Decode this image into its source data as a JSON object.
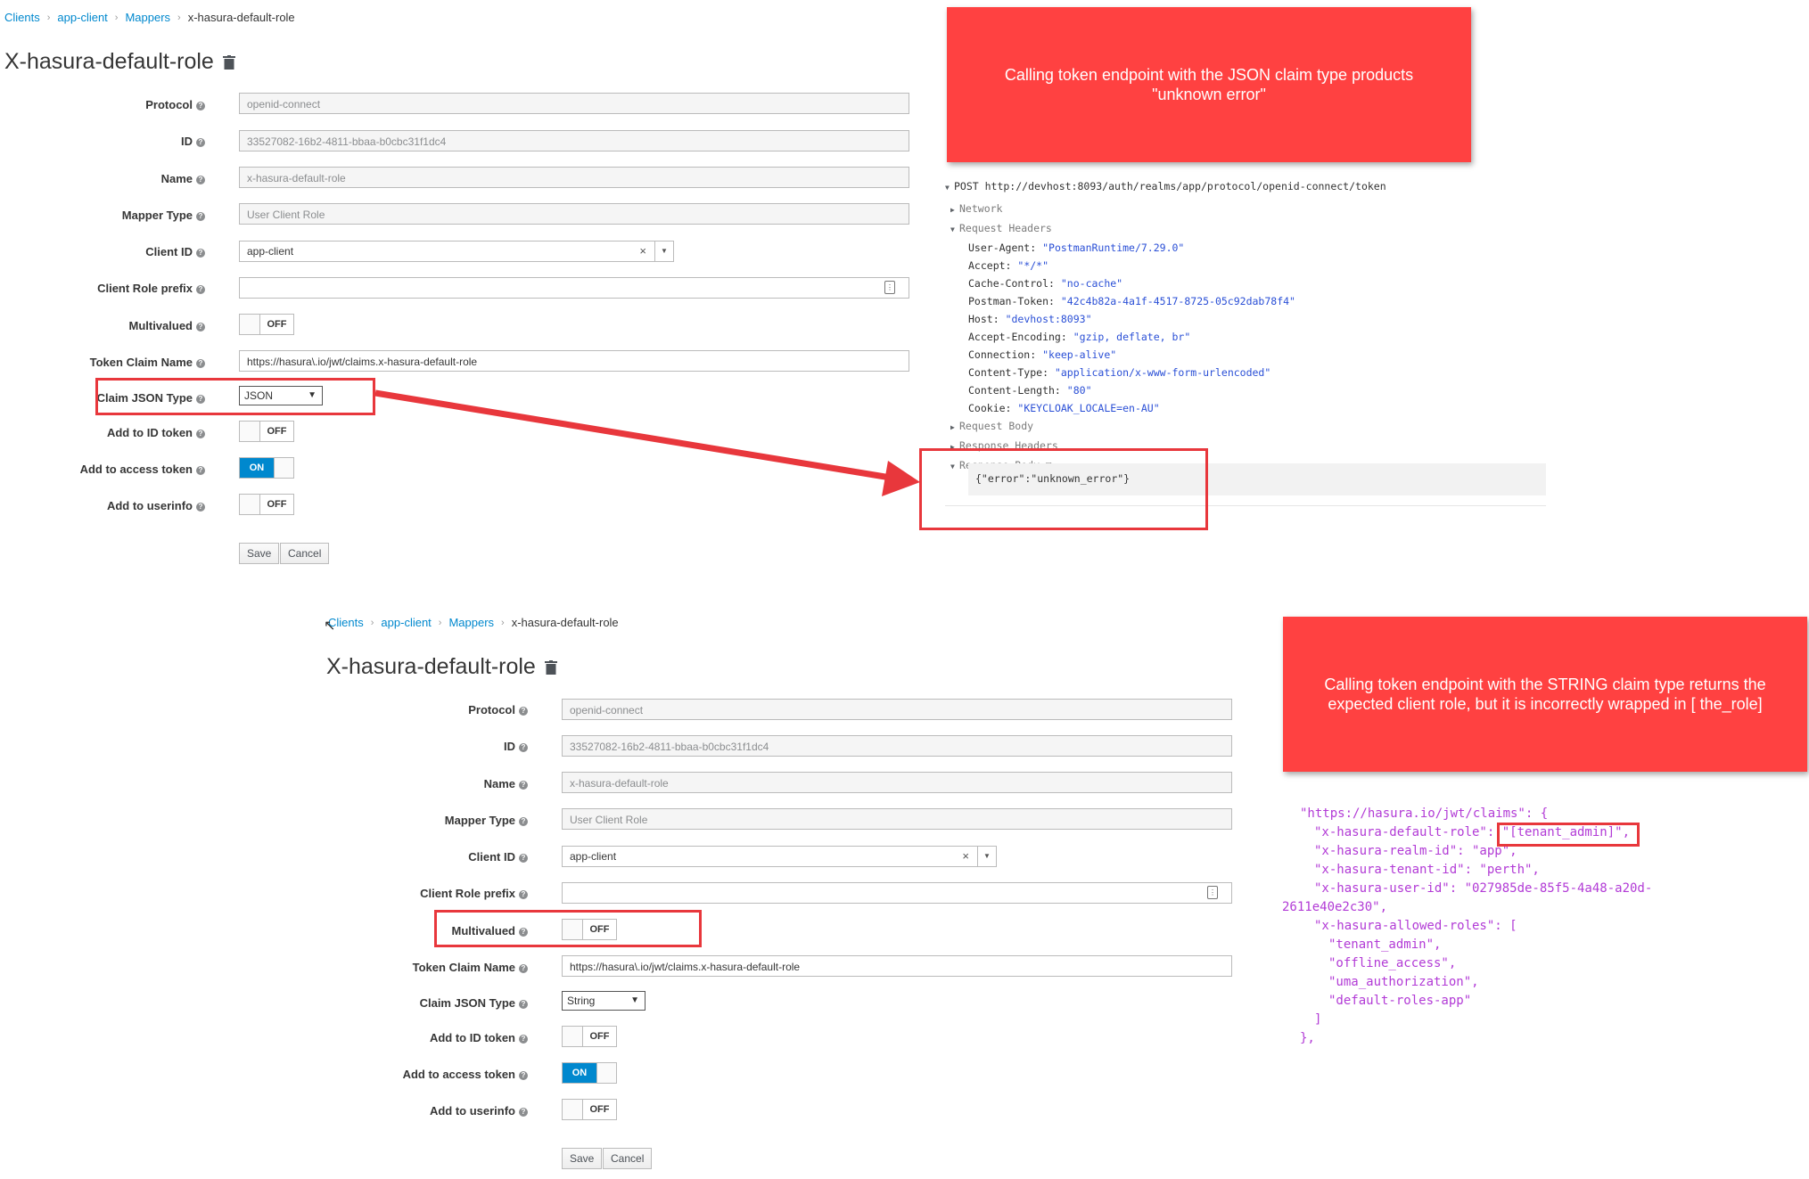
{
  "top": {
    "breadcrumb": [
      "Clients",
      "app-client",
      "Mappers",
      "x-hasura-default-role"
    ],
    "title": "X-hasura-default-role",
    "fields": {
      "protocol": {
        "label": "Protocol",
        "value": "openid-connect"
      },
      "id": {
        "label": "ID",
        "value": "33527082-16b2-4811-bbaa-b0cbc31f1dc4"
      },
      "name": {
        "label": "Name",
        "value": "x-hasura-default-role"
      },
      "mapper_type": {
        "label": "Mapper Type",
        "value": "User Client Role"
      },
      "client_id": {
        "label": "Client ID",
        "value": "app-client"
      },
      "client_role_prefix": {
        "label": "Client Role prefix",
        "value": ""
      },
      "multivalued": {
        "label": "Multivalued",
        "value": "OFF"
      },
      "token_claim_name": {
        "label": "Token Claim Name",
        "value": "https://hasura\\.io/jwt/claims.x-hasura-default-role"
      },
      "claim_json_type": {
        "label": "Claim JSON Type",
        "value": "JSON"
      },
      "add_id_token": {
        "label": "Add to ID token",
        "value": "OFF"
      },
      "add_access_token": {
        "label": "Add to access token",
        "value": "ON"
      },
      "add_userinfo": {
        "label": "Add to userinfo",
        "value": "OFF"
      }
    },
    "save": "Save",
    "cancel": "Cancel"
  },
  "bottom": {
    "breadcrumb": [
      "Clients",
      "app-client",
      "Mappers",
      "x-hasura-default-role"
    ],
    "title": "X-hasura-default-role",
    "fields": {
      "protocol": {
        "label": "Protocol",
        "value": "openid-connect"
      },
      "id": {
        "label": "ID",
        "value": "33527082-16b2-4811-bbaa-b0cbc31f1dc4"
      },
      "name": {
        "label": "Name",
        "value": "x-hasura-default-role"
      },
      "mapper_type": {
        "label": "Mapper Type",
        "value": "User Client Role"
      },
      "client_id": {
        "label": "Client ID",
        "value": "app-client"
      },
      "client_role_prefix": {
        "label": "Client Role prefix",
        "value": ""
      },
      "multivalued": {
        "label": "Multivalued",
        "value": "OFF"
      },
      "token_claim_name": {
        "label": "Token Claim Name",
        "value": "https://hasura\\.io/jwt/claims.x-hasura-default-role"
      },
      "claim_json_type": {
        "label": "Claim JSON Type",
        "value": "String"
      },
      "add_id_token": {
        "label": "Add to ID token",
        "value": "OFF"
      },
      "add_access_token": {
        "label": "Add to access token",
        "value": "ON"
      },
      "add_userinfo": {
        "label": "Add to userinfo",
        "value": "OFF"
      }
    },
    "save": "Save",
    "cancel": "Cancel"
  },
  "callouts": {
    "json": "Calling token endpoint with the JSON claim type products \"unknown error\"",
    "string": "Calling token endpoint with the STRING claim type returns the expected client role, but it is incorrectly wrapped in [ the_role]"
  },
  "devtools": {
    "request_line": "POST http://devhost:8093/auth/realms/app/protocol/openid-connect/token",
    "network": "Network",
    "request_headers": "Request Headers",
    "headers": [
      {
        "k": "User-Agent:",
        "v": "\"PostmanRuntime/7.29.0\""
      },
      {
        "k": "Accept:",
        "v": "\"*/*\""
      },
      {
        "k": "Cache-Control:",
        "v": "\"no-cache\""
      },
      {
        "k": "Postman-Token:",
        "v": "\"42c4b82a-4a1f-4517-8725-05c92dab78f4\""
      },
      {
        "k": "Host:",
        "v": "\"devhost:8093\""
      },
      {
        "k": "Accept-Encoding:",
        "v": "\"gzip, deflate, br\""
      },
      {
        "k": "Connection:",
        "v": "\"keep-alive\""
      },
      {
        "k": "Content-Type:",
        "v": "\"application/x-www-form-urlencoded\""
      },
      {
        "k": "Content-Length:",
        "v": "\"80\""
      },
      {
        "k": "Cookie:",
        "v": "\"KEYCLOAK_LOCALE=en-AU\""
      }
    ],
    "request_body": "Request Body",
    "response_headers": "Response Headers",
    "response_body": "Response Body",
    "response_body_value": "{\"error\":\"unknown_error\"}"
  },
  "claims_json": {
    "l1": "\"https://hasura.io/jwt/claims\": {",
    "l2_key": "\"x-hasura-default-role\": ",
    "l2_val": "\"[tenant_admin]\"",
    "l2_end": ",",
    "l3": "\"x-hasura-realm-id\": \"app\",",
    "l4": "\"x-hasura-tenant-id\": \"perth\",",
    "l5": "\"x-hasura-user-id\": \"027985de-85f5-4a48-a20d-",
    "l6": "2611e40e2c30\",",
    "l7": "\"x-hasura-allowed-roles\": [",
    "l8": "\"tenant_admin\",",
    "l9": "\"offline_access\",",
    "l10": "\"uma_authorization\",",
    "l11": "\"default-roles-app\"",
    "l12": "]",
    "l13": "},"
  }
}
